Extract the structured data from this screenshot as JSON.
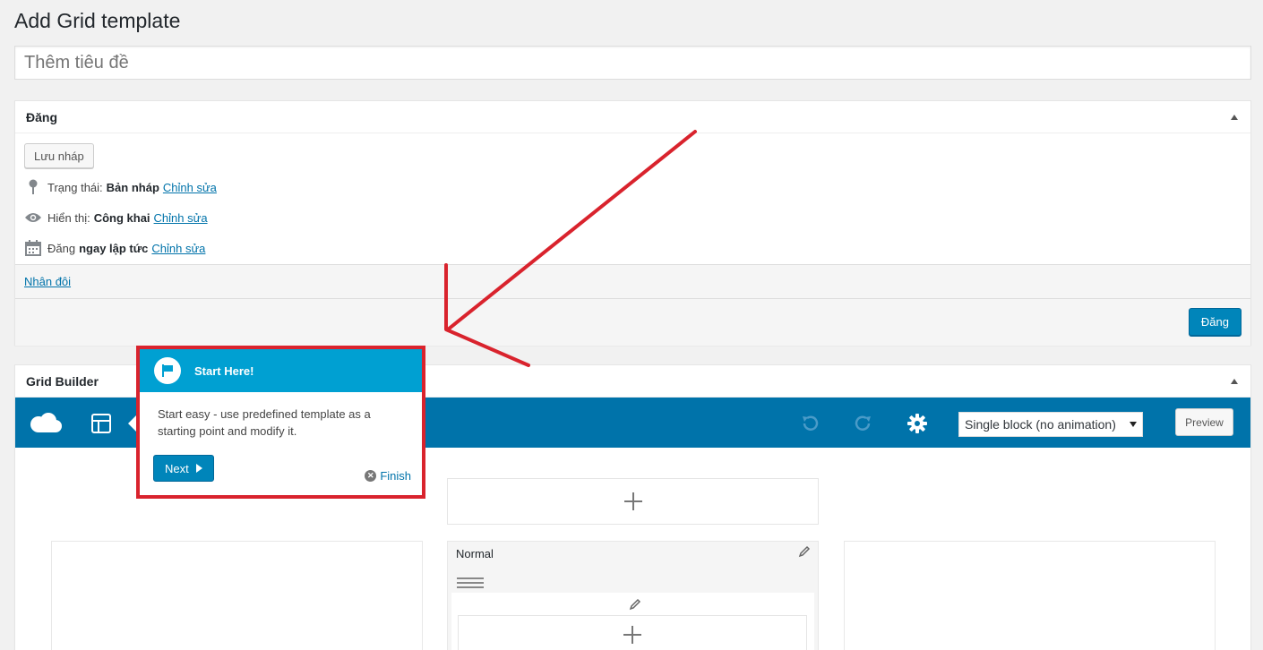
{
  "page": {
    "title": "Add Grid template"
  },
  "title_input": {
    "placeholder": "Thêm tiêu đề"
  },
  "publish": {
    "heading": "Đăng",
    "save_draft": "Lưu nháp",
    "status_label": "Trạng thái:",
    "status_value": "Bản nháp",
    "visibility_label": "Hiển thị:",
    "visibility_value": "Công khai",
    "schedule_label": "Đăng",
    "schedule_value": "ngay lập tức",
    "edit_link": "Chỉnh sửa",
    "duplicate": "Nhân đôi",
    "publish_button": "Đăng"
  },
  "grid_builder": {
    "heading": "Grid Builder",
    "animation_select": "Single block (no animation)",
    "preview": "Preview",
    "column_title": "Normal"
  },
  "tour": {
    "title": "Start Here!",
    "body": "Start easy - use predefined template as a starting point and modify it.",
    "next": "Next",
    "finish": "Finish"
  },
  "colors": {
    "toolbar": "#0073aa",
    "tour_header": "#00a0d2",
    "highlight": "#d9232d",
    "primary_button": "#0085ba"
  }
}
